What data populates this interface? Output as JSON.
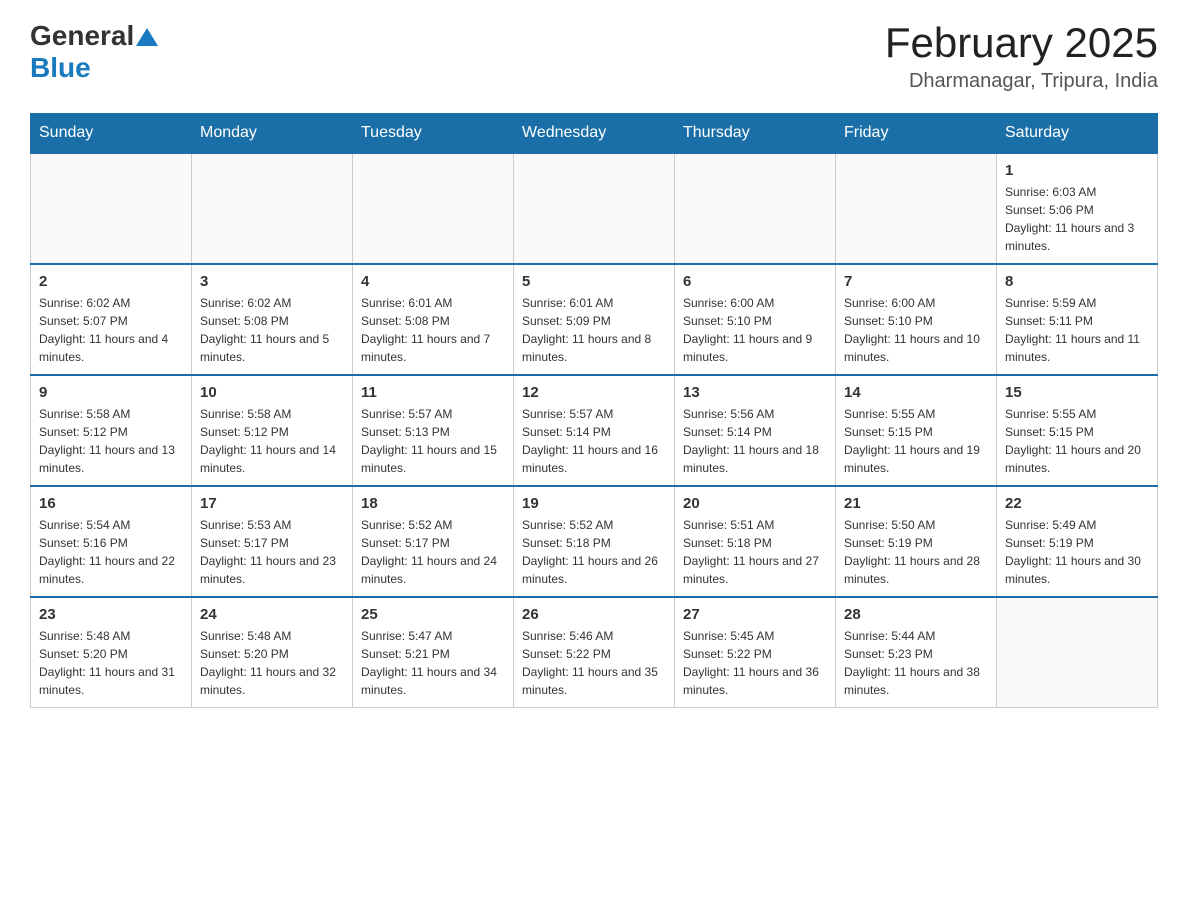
{
  "header": {
    "logo": {
      "general": "General",
      "blue": "Blue",
      "triangle_color": "#1a7abf"
    },
    "title": "February 2025",
    "location": "Dharmanagar, Tripura, India"
  },
  "calendar": {
    "days_of_week": [
      "Sunday",
      "Monday",
      "Tuesday",
      "Wednesday",
      "Thursday",
      "Friday",
      "Saturday"
    ],
    "weeks": [
      [
        {
          "day": "",
          "info": ""
        },
        {
          "day": "",
          "info": ""
        },
        {
          "day": "",
          "info": ""
        },
        {
          "day": "",
          "info": ""
        },
        {
          "day": "",
          "info": ""
        },
        {
          "day": "",
          "info": ""
        },
        {
          "day": "1",
          "info": "Sunrise: 6:03 AM\nSunset: 5:06 PM\nDaylight: 11 hours and 3 minutes."
        }
      ],
      [
        {
          "day": "2",
          "info": "Sunrise: 6:02 AM\nSunset: 5:07 PM\nDaylight: 11 hours and 4 minutes."
        },
        {
          "day": "3",
          "info": "Sunrise: 6:02 AM\nSunset: 5:08 PM\nDaylight: 11 hours and 5 minutes."
        },
        {
          "day": "4",
          "info": "Sunrise: 6:01 AM\nSunset: 5:08 PM\nDaylight: 11 hours and 7 minutes."
        },
        {
          "day": "5",
          "info": "Sunrise: 6:01 AM\nSunset: 5:09 PM\nDaylight: 11 hours and 8 minutes."
        },
        {
          "day": "6",
          "info": "Sunrise: 6:00 AM\nSunset: 5:10 PM\nDaylight: 11 hours and 9 minutes."
        },
        {
          "day": "7",
          "info": "Sunrise: 6:00 AM\nSunset: 5:10 PM\nDaylight: 11 hours and 10 minutes."
        },
        {
          "day": "8",
          "info": "Sunrise: 5:59 AM\nSunset: 5:11 PM\nDaylight: 11 hours and 11 minutes."
        }
      ],
      [
        {
          "day": "9",
          "info": "Sunrise: 5:58 AM\nSunset: 5:12 PM\nDaylight: 11 hours and 13 minutes."
        },
        {
          "day": "10",
          "info": "Sunrise: 5:58 AM\nSunset: 5:12 PM\nDaylight: 11 hours and 14 minutes."
        },
        {
          "day": "11",
          "info": "Sunrise: 5:57 AM\nSunset: 5:13 PM\nDaylight: 11 hours and 15 minutes."
        },
        {
          "day": "12",
          "info": "Sunrise: 5:57 AM\nSunset: 5:14 PM\nDaylight: 11 hours and 16 minutes."
        },
        {
          "day": "13",
          "info": "Sunrise: 5:56 AM\nSunset: 5:14 PM\nDaylight: 11 hours and 18 minutes."
        },
        {
          "day": "14",
          "info": "Sunrise: 5:55 AM\nSunset: 5:15 PM\nDaylight: 11 hours and 19 minutes."
        },
        {
          "day": "15",
          "info": "Sunrise: 5:55 AM\nSunset: 5:15 PM\nDaylight: 11 hours and 20 minutes."
        }
      ],
      [
        {
          "day": "16",
          "info": "Sunrise: 5:54 AM\nSunset: 5:16 PM\nDaylight: 11 hours and 22 minutes."
        },
        {
          "day": "17",
          "info": "Sunrise: 5:53 AM\nSunset: 5:17 PM\nDaylight: 11 hours and 23 minutes."
        },
        {
          "day": "18",
          "info": "Sunrise: 5:52 AM\nSunset: 5:17 PM\nDaylight: 11 hours and 24 minutes."
        },
        {
          "day": "19",
          "info": "Sunrise: 5:52 AM\nSunset: 5:18 PM\nDaylight: 11 hours and 26 minutes."
        },
        {
          "day": "20",
          "info": "Sunrise: 5:51 AM\nSunset: 5:18 PM\nDaylight: 11 hours and 27 minutes."
        },
        {
          "day": "21",
          "info": "Sunrise: 5:50 AM\nSunset: 5:19 PM\nDaylight: 11 hours and 28 minutes."
        },
        {
          "day": "22",
          "info": "Sunrise: 5:49 AM\nSunset: 5:19 PM\nDaylight: 11 hours and 30 minutes."
        }
      ],
      [
        {
          "day": "23",
          "info": "Sunrise: 5:48 AM\nSunset: 5:20 PM\nDaylight: 11 hours and 31 minutes."
        },
        {
          "day": "24",
          "info": "Sunrise: 5:48 AM\nSunset: 5:20 PM\nDaylight: 11 hours and 32 minutes."
        },
        {
          "day": "25",
          "info": "Sunrise: 5:47 AM\nSunset: 5:21 PM\nDaylight: 11 hours and 34 minutes."
        },
        {
          "day": "26",
          "info": "Sunrise: 5:46 AM\nSunset: 5:22 PM\nDaylight: 11 hours and 35 minutes."
        },
        {
          "day": "27",
          "info": "Sunrise: 5:45 AM\nSunset: 5:22 PM\nDaylight: 11 hours and 36 minutes."
        },
        {
          "day": "28",
          "info": "Sunrise: 5:44 AM\nSunset: 5:23 PM\nDaylight: 11 hours and 38 minutes."
        },
        {
          "day": "",
          "info": ""
        }
      ]
    ]
  }
}
